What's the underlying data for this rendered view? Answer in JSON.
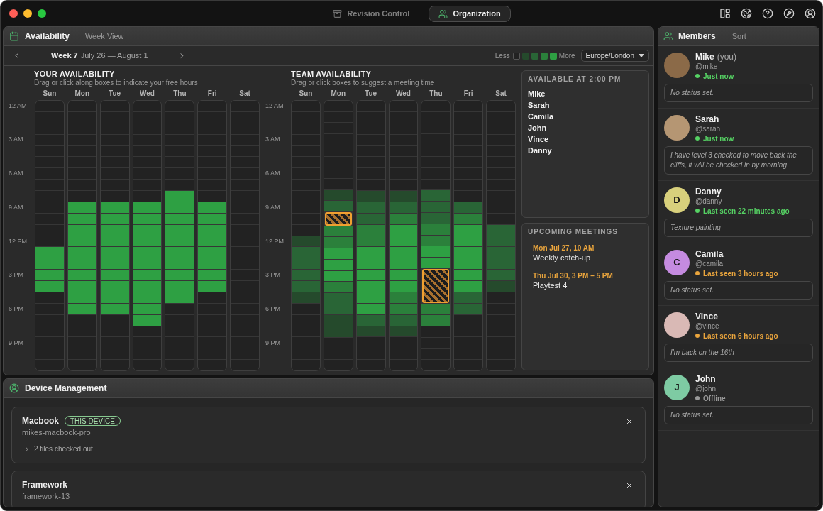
{
  "title_bar": {
    "tabs": [
      {
        "label": "Revision Control",
        "selected": false
      },
      {
        "label": "Organization",
        "selected": true
      }
    ]
  },
  "availability": {
    "title": "Availability",
    "view": "Week View",
    "week": {
      "label": "Week 7",
      "range": "July 26 — August 1"
    },
    "legend": {
      "less": "Less",
      "more": "More",
      "swatches": [
        {
          "color": "#222222"
        },
        {
          "color": "#254a2c"
        },
        {
          "color": "#296536"
        },
        {
          "color": "#2b803b"
        },
        {
          "color": "#2ea043"
        }
      ]
    },
    "timezone": {
      "value": "Europe/London"
    }
  },
  "your_availability": {
    "title": "YOUR AVAILABILITY",
    "subtitle": "Drag or click along boxes to indicate your free hours",
    "time_labels": [
      "12 AM",
      "3 AM",
      "6 AM",
      "9 AM",
      "12 PM",
      "3 PM",
      "6 PM",
      "9 PM"
    ],
    "days": [
      {
        "label": "Sun",
        "free": [
          false,
          false,
          false,
          false,
          false,
          false,
          false,
          false,
          false,
          false,
          false,
          false,
          false,
          true,
          true,
          true,
          true,
          false,
          false,
          false,
          false,
          false,
          false,
          false
        ]
      },
      {
        "label": "Mon",
        "free": [
          false,
          false,
          false,
          false,
          false,
          false,
          false,
          false,
          false,
          true,
          true,
          true,
          true,
          true,
          true,
          true,
          true,
          true,
          true,
          false,
          false,
          false,
          false,
          false
        ]
      },
      {
        "label": "Tue",
        "free": [
          false,
          false,
          false,
          false,
          false,
          false,
          false,
          false,
          false,
          true,
          true,
          true,
          true,
          true,
          true,
          true,
          true,
          true,
          true,
          false,
          false,
          false,
          false,
          false
        ]
      },
      {
        "label": "Wed",
        "free": [
          false,
          false,
          false,
          false,
          false,
          false,
          false,
          false,
          false,
          true,
          true,
          true,
          true,
          true,
          true,
          true,
          true,
          true,
          true,
          true,
          false,
          false,
          false,
          false
        ]
      },
      {
        "label": "Thu",
        "free": [
          false,
          false,
          false,
          false,
          false,
          false,
          false,
          false,
          true,
          true,
          true,
          true,
          true,
          true,
          true,
          true,
          true,
          true,
          false,
          false,
          false,
          false,
          false,
          false
        ]
      },
      {
        "label": "Fri",
        "free": [
          false,
          false,
          false,
          false,
          false,
          false,
          false,
          false,
          false,
          true,
          true,
          true,
          true,
          true,
          true,
          true,
          true,
          false,
          false,
          false,
          false,
          false,
          false,
          false
        ]
      },
      {
        "label": "Sat",
        "free": [
          false,
          false,
          false,
          false,
          false,
          false,
          false,
          false,
          false,
          false,
          false,
          false,
          false,
          false,
          false,
          false,
          false,
          false,
          false,
          false,
          false,
          false,
          false,
          false
        ]
      }
    ]
  },
  "team_availability": {
    "title": "TEAM AVAILABILITY",
    "subtitle": "Drag or click boxes to suggest a meeting time",
    "time_labels": [
      "12 AM",
      "3 AM",
      "6 AM",
      "9 AM",
      "12 PM",
      "3 PM",
      "6 PM",
      "9 PM"
    ],
    "days": [
      {
        "label": "Sun",
        "cells": [
          {
            "color": "#222222",
            "meeting": false
          },
          {
            "color": "#222222",
            "meeting": false
          },
          {
            "color": "#222222",
            "meeting": false
          },
          {
            "color": "#222222",
            "meeting": false
          },
          {
            "color": "#222222",
            "meeting": false
          },
          {
            "color": "#222222",
            "meeting": false
          },
          {
            "color": "#222222",
            "meeting": false
          },
          {
            "color": "#222222",
            "meeting": false
          },
          {
            "color": "#222222",
            "meeting": false
          },
          {
            "color": "#222222",
            "meeting": false
          },
          {
            "color": "#222222",
            "meeting": false
          },
          {
            "color": "#222222",
            "meeting": false
          },
          {
            "color": "#254a2c",
            "meeting": false
          },
          {
            "color": "#296536",
            "meeting": false
          },
          {
            "color": "#296536",
            "meeting": false
          },
          {
            "color": "#296536",
            "meeting": false
          },
          {
            "color": "#296536",
            "meeting": false
          },
          {
            "color": "#254a2c",
            "meeting": false
          },
          {
            "color": "#222222",
            "meeting": false
          },
          {
            "color": "#222222",
            "meeting": false
          },
          {
            "color": "#222222",
            "meeting": false
          },
          {
            "color": "#222222",
            "meeting": false
          },
          {
            "color": "#222222",
            "meeting": false
          },
          {
            "color": "#222222",
            "meeting": false
          }
        ]
      },
      {
        "label": "Mon",
        "cells": [
          {
            "color": "#222222",
            "meeting": false
          },
          {
            "color": "#222222",
            "meeting": false
          },
          {
            "color": "#222222",
            "meeting": false
          },
          {
            "color": "#222222",
            "meeting": false
          },
          {
            "color": "#222222",
            "meeting": false
          },
          {
            "color": "#222222",
            "meeting": false
          },
          {
            "color": "#222222",
            "meeting": false
          },
          {
            "color": "#222222",
            "meeting": false
          },
          {
            "color": "#254a2c",
            "meeting": false
          },
          {
            "color": "#296536",
            "meeting": false
          },
          {
            "meeting": true
          },
          {
            "color": "#2b803b",
            "meeting": false
          },
          {
            "color": "#2b803b",
            "meeting": false
          },
          {
            "color": "#2ea043",
            "meeting": false
          },
          {
            "color": "#2ea043",
            "meeting": false
          },
          {
            "color": "#2ea043",
            "meeting": false
          },
          {
            "color": "#2b803b",
            "meeting": false
          },
          {
            "color": "#296536",
            "meeting": false
          },
          {
            "color": "#296536",
            "meeting": false
          },
          {
            "color": "#254a2c",
            "meeting": false
          },
          {
            "color": "#254a2c",
            "meeting": false
          },
          {
            "color": "#222222",
            "meeting": false
          },
          {
            "color": "#222222",
            "meeting": false
          },
          {
            "color": "#222222",
            "meeting": false
          }
        ]
      },
      {
        "label": "Tue",
        "cells": [
          {
            "color": "#222222",
            "meeting": false
          },
          {
            "color": "#222222",
            "meeting": false
          },
          {
            "color": "#222222",
            "meeting": false
          },
          {
            "color": "#222222",
            "meeting": false
          },
          {
            "color": "#222222",
            "meeting": false
          },
          {
            "color": "#222222",
            "meeting": false
          },
          {
            "color": "#222222",
            "meeting": false
          },
          {
            "color": "#222222",
            "meeting": false
          },
          {
            "color": "#254a2c",
            "meeting": false
          },
          {
            "color": "#296536",
            "meeting": false
          },
          {
            "color": "#296536",
            "meeting": false
          },
          {
            "color": "#2b803b",
            "meeting": false
          },
          {
            "color": "#2b803b",
            "meeting": false
          },
          {
            "color": "#2ea043",
            "meeting": false
          },
          {
            "color": "#2ea043",
            "meeting": false
          },
          {
            "color": "#2ea043",
            "meeting": false
          },
          {
            "color": "#2ea043",
            "meeting": false
          },
          {
            "color": "#2ea043",
            "meeting": false
          },
          {
            "color": "#2ea043",
            "meeting": false
          },
          {
            "color": "#296536",
            "meeting": false
          },
          {
            "color": "#254a2c",
            "meeting": false
          },
          {
            "color": "#222222",
            "meeting": false
          },
          {
            "color": "#222222",
            "meeting": false
          },
          {
            "color": "#222222",
            "meeting": false
          }
        ]
      },
      {
        "label": "Wed",
        "cells": [
          {
            "color": "#222222",
            "meeting": false
          },
          {
            "color": "#222222",
            "meeting": false
          },
          {
            "color": "#222222",
            "meeting": false
          },
          {
            "color": "#222222",
            "meeting": false
          },
          {
            "color": "#222222",
            "meeting": false
          },
          {
            "color": "#222222",
            "meeting": false
          },
          {
            "color": "#222222",
            "meeting": false
          },
          {
            "color": "#222222",
            "meeting": false
          },
          {
            "color": "#254a2c",
            "meeting": false
          },
          {
            "color": "#296536",
            "meeting": false
          },
          {
            "color": "#2b803b",
            "meeting": false
          },
          {
            "color": "#2ea043",
            "meeting": false
          },
          {
            "color": "#2ea043",
            "meeting": false
          },
          {
            "color": "#2ea043",
            "meeting": false
          },
          {
            "color": "#2ea043",
            "meeting": false
          },
          {
            "color": "#2ea043",
            "meeting": false
          },
          {
            "color": "#2ea043",
            "meeting": false
          },
          {
            "color": "#2b803b",
            "meeting": false
          },
          {
            "color": "#2b803b",
            "meeting": false
          },
          {
            "color": "#296536",
            "meeting": false
          },
          {
            "color": "#254a2c",
            "meeting": false
          },
          {
            "color": "#222222",
            "meeting": false
          },
          {
            "color": "#222222",
            "meeting": false
          },
          {
            "color": "#222222",
            "meeting": false
          }
        ]
      },
      {
        "label": "Thu",
        "cells": [
          {
            "color": "#222222",
            "meeting": false
          },
          {
            "color": "#222222",
            "meeting": false
          },
          {
            "color": "#222222",
            "meeting": false
          },
          {
            "color": "#222222",
            "meeting": false
          },
          {
            "color": "#222222",
            "meeting": false
          },
          {
            "color": "#222222",
            "meeting": false
          },
          {
            "color": "#222222",
            "meeting": false
          },
          {
            "color": "#222222",
            "meeting": false
          },
          {
            "color": "#296536",
            "meeting": false
          },
          {
            "color": "#296536",
            "meeting": false
          },
          {
            "color": "#296536",
            "meeting": false
          },
          {
            "color": "#2b803b",
            "meeting": false
          },
          {
            "color": "#2b803b",
            "meeting": false
          },
          {
            "color": "#2ea043",
            "meeting": false
          },
          {
            "color": "#2ea043",
            "meeting": false
          },
          {
            "meeting": true
          },
          {
            "meeting": true
          },
          {
            "meeting": true
          },
          {
            "color": "#2b803b",
            "meeting": false
          },
          {
            "color": "#2b803b",
            "meeting": false
          },
          {
            "color": "#222222",
            "meeting": false
          },
          {
            "color": "#222222",
            "meeting": false
          },
          {
            "color": "#222222",
            "meeting": false
          },
          {
            "color": "#222222",
            "meeting": false
          }
        ]
      },
      {
        "label": "Fri",
        "cells": [
          {
            "color": "#222222",
            "meeting": false
          },
          {
            "color": "#222222",
            "meeting": false
          },
          {
            "color": "#222222",
            "meeting": false
          },
          {
            "color": "#222222",
            "meeting": false
          },
          {
            "color": "#222222",
            "meeting": false
          },
          {
            "color": "#222222",
            "meeting": false
          },
          {
            "color": "#222222",
            "meeting": false
          },
          {
            "color": "#222222",
            "meeting": false
          },
          {
            "color": "#222222",
            "meeting": false
          },
          {
            "color": "#296536",
            "meeting": false
          },
          {
            "color": "#2b803b",
            "meeting": false
          },
          {
            "color": "#2ea043",
            "meeting": false
          },
          {
            "color": "#2ea043",
            "meeting": false
          },
          {
            "color": "#2ea043",
            "meeting": false
          },
          {
            "color": "#2ea043",
            "meeting": false
          },
          {
            "color": "#2ea043",
            "meeting": false
          },
          {
            "color": "#2ea043",
            "meeting": false
          },
          {
            "color": "#296536",
            "meeting": false
          },
          {
            "color": "#296536",
            "meeting": false
          },
          {
            "color": "#222222",
            "meeting": false
          },
          {
            "color": "#222222",
            "meeting": false
          },
          {
            "color": "#222222",
            "meeting": false
          },
          {
            "color": "#222222",
            "meeting": false
          },
          {
            "color": "#222222",
            "meeting": false
          }
        ]
      },
      {
        "label": "Sat",
        "cells": [
          {
            "color": "#222222",
            "meeting": false
          },
          {
            "color": "#222222",
            "meeting": false
          },
          {
            "color": "#222222",
            "meeting": false
          },
          {
            "color": "#222222",
            "meeting": false
          },
          {
            "color": "#222222",
            "meeting": false
          },
          {
            "color": "#222222",
            "meeting": false
          },
          {
            "color": "#222222",
            "meeting": false
          },
          {
            "color": "#222222",
            "meeting": false
          },
          {
            "color": "#222222",
            "meeting": false
          },
          {
            "color": "#222222",
            "meeting": false
          },
          {
            "color": "#222222",
            "meeting": false
          },
          {
            "color": "#296536",
            "meeting": false
          },
          {
            "color": "#296536",
            "meeting": false
          },
          {
            "color": "#296536",
            "meeting": false
          },
          {
            "color": "#296536",
            "meeting": false
          },
          {
            "color": "#296536",
            "meeting": false
          },
          {
            "color": "#254a2c",
            "meeting": false
          },
          {
            "color": "#222222",
            "meeting": false
          },
          {
            "color": "#222222",
            "meeting": false
          },
          {
            "color": "#222222",
            "meeting": false
          },
          {
            "color": "#222222",
            "meeting": false
          },
          {
            "color": "#222222",
            "meeting": false
          },
          {
            "color": "#222222",
            "meeting": false
          },
          {
            "color": "#222222",
            "meeting": false
          }
        ]
      }
    ]
  },
  "available_at": {
    "title": "AVAILABLE AT 2:00 PM",
    "names": [
      "Mike",
      "Sarah",
      "Camila",
      "John",
      "Vince",
      "Danny"
    ]
  },
  "upcoming_meetings": {
    "title": "UPCOMING MEETINGS",
    "items": [
      {
        "when": "Mon Jul 27, 10 AM",
        "title": "Weekly catch-up"
      },
      {
        "when": "Thu Jul 30, 3 PM – 5 PM",
        "title": "Playtest 4"
      }
    ]
  },
  "device_management": {
    "title": "Device Management",
    "devices": [
      {
        "name": "Macbook",
        "badge": "THIS DEVICE",
        "host": "mikes-macbook-pro",
        "files": {
          "label": "2 files checked out",
          "expanded": false
        }
      },
      {
        "name": "Framework",
        "host": "framework-13"
      }
    ]
  },
  "members": {
    "title": "Members",
    "sort": "Sort",
    "items": [
      {
        "name": "Mike",
        "suffix": "(you)",
        "handle": "@mike",
        "avatar": {
          "kind": "photo",
          "color": "#8b6a48"
        },
        "status": {
          "text": "Just now",
          "color": "#56d364"
        },
        "note": "No status set."
      },
      {
        "name": "Sarah",
        "handle": "@sarah",
        "avatar": {
          "kind": "photo",
          "color": "#b59673"
        },
        "status": {
          "text": "Just now",
          "color": "#56d364"
        },
        "note": "I have level 3 checked to move back the cliffs, it will be checked in by morning"
      },
      {
        "name": "Danny",
        "handle": "@danny",
        "avatar": {
          "kind": "initial",
          "letter": "D",
          "color": "#d8d07c"
        },
        "status": {
          "text": "Last seen 22 minutes ago",
          "color": "#56d364"
        },
        "note": "Texture painting"
      },
      {
        "name": "Camila",
        "handle": "@camila",
        "avatar": {
          "kind": "initial",
          "letter": "C",
          "color": "#c58be0"
        },
        "status": {
          "text": "Last seen 3 hours ago",
          "color": "#eaa53d"
        },
        "note": "No status set."
      },
      {
        "name": "Vince",
        "handle": "@vince",
        "avatar": {
          "kind": "photo",
          "color": "#d9b9b5"
        },
        "status": {
          "text": "Last seen 6 hours ago",
          "color": "#eaa53d"
        },
        "note": "I'm back on the 16th"
      },
      {
        "name": "John",
        "handle": "@john",
        "avatar": {
          "kind": "initial",
          "letter": "J",
          "color": "#7ecba3"
        },
        "status": {
          "text": "Offline",
          "color": "#999999"
        },
        "note": "No status set."
      }
    ]
  }
}
